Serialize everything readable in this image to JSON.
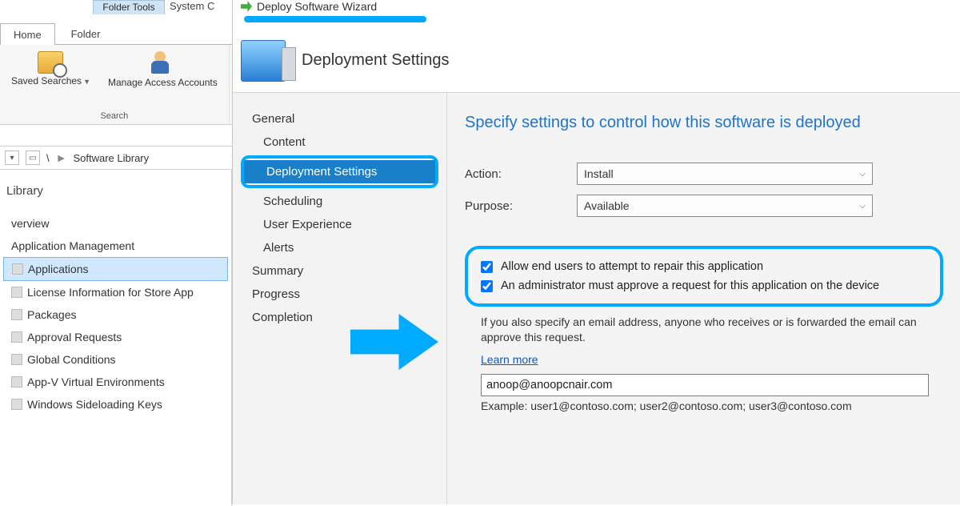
{
  "topTabs": {
    "folderTools": "Folder Tools",
    "system": "System C"
  },
  "ribbon": {
    "tabs": {
      "home": "Home",
      "folder": "Folder"
    },
    "savedSearches": "Saved\nSearches",
    "manageAccess": "Manage Access\nAccounts",
    "groupLabel": "Search"
  },
  "breadcrumb": {
    "root": "\\",
    "sep": "►",
    "lib": "Software Library"
  },
  "nav": {
    "header": "Library",
    "overview": "verview",
    "appMgmt": "Application Management",
    "items": [
      "Applications",
      "License Information for Store App",
      "Packages",
      "Approval Requests",
      "Global Conditions",
      "App-V Virtual Environments",
      "Windows Sideloading Keys"
    ]
  },
  "wizard": {
    "title": "Deploy Software Wizard",
    "header": "Deployment Settings",
    "steps": {
      "general": "General",
      "content": "Content",
      "deploy": "Deployment Settings",
      "sched": "Scheduling",
      "ux": "User Experience",
      "alerts": "Alerts",
      "summary": "Summary",
      "progress": "Progress",
      "completion": "Completion"
    },
    "main": {
      "heading": "Specify settings to control how this software is deployed",
      "actionLabel": "Action:",
      "actionValue": "Install",
      "purposeLabel": "Purpose:",
      "purposeValue": "Available",
      "check1": "Allow end users to attempt to repair this application",
      "check2": "An administrator must approve a request for this application on the device",
      "hint": "If you also specify an email address, anyone who receives or is forwarded the email can approve this request.",
      "learn": "Learn more",
      "email": "anoop@anoopcnair.com",
      "example": "Example: user1@contoso.com; user2@contoso.com; user3@contoso.com"
    }
  }
}
